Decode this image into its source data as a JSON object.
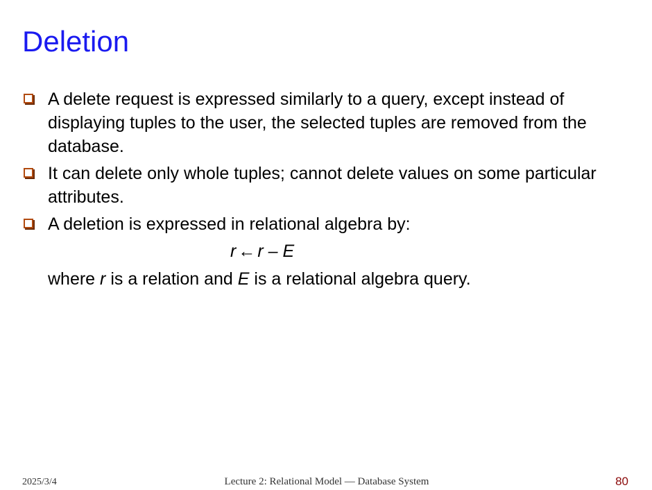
{
  "slide": {
    "title": "Deletion",
    "bullets": [
      {
        "text": "A delete request is expressed similarly to a query, except instead of displaying tuples to the user, the selected tuples are removed from the database."
      },
      {
        "text": "It can delete only whole tuples; cannot delete values on some particular attributes."
      },
      {
        "text": "A deletion is expressed in relational algebra by:"
      }
    ],
    "formula": {
      "lhs": "r",
      "arrow": "←",
      "rhs": "r – E"
    },
    "where_line": {
      "part1": "where ",
      "var_r": "r",
      "part2": " is a relation and ",
      "var_e": "E",
      "part3": " is a relational algebra query."
    }
  },
  "footer": {
    "date": "2025/3/4",
    "center_text": "Lecture 2: Relational Model — Database System",
    "page_number": "80"
  },
  "colors": {
    "title": "#1a1af0",
    "bullet_box": "#b14a0f",
    "page_number": "#8b0a0a"
  },
  "icons": {
    "bullet": "checkbox-square-bullet-icon"
  }
}
